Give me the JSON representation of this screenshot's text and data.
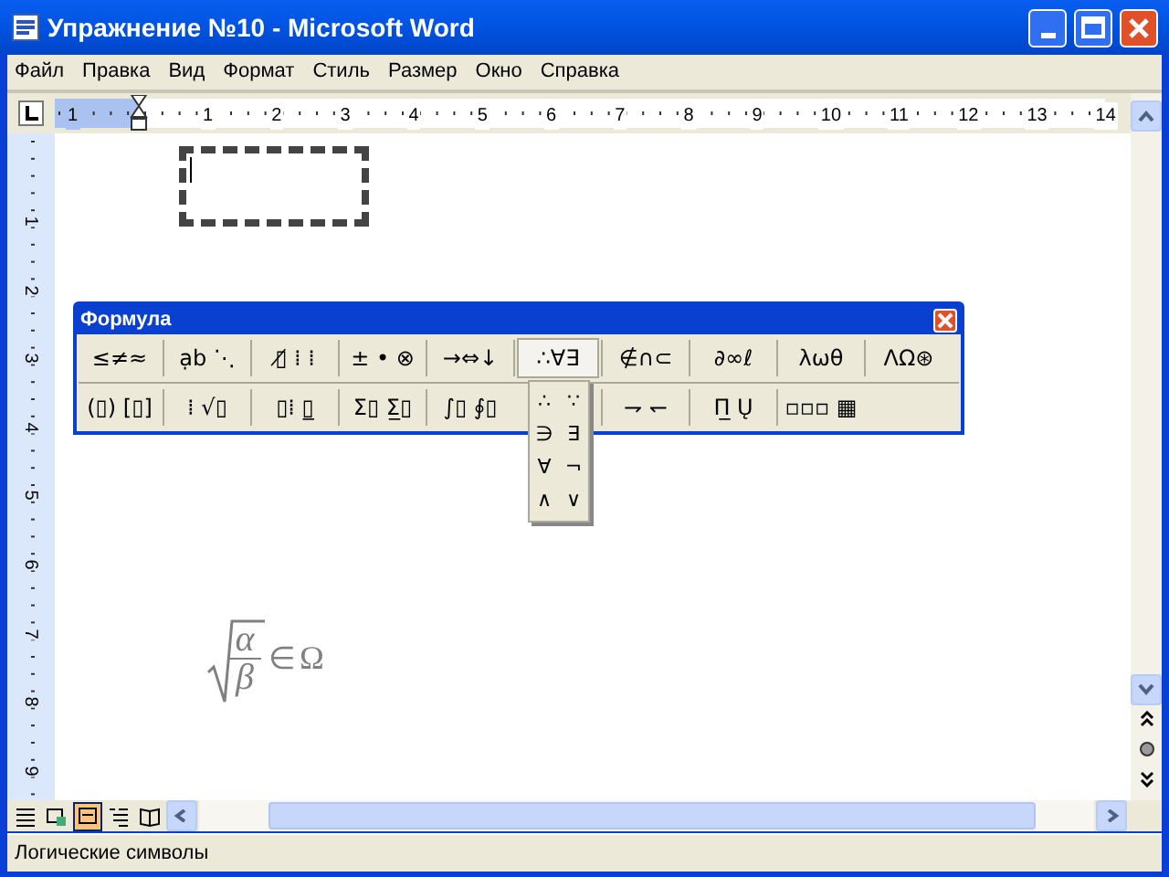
{
  "window": {
    "title": "Упражнение №10 - Microsoft Word"
  },
  "menu": [
    "Файл",
    "Правка",
    "Вид",
    "Формат",
    "Стиль",
    "Размер",
    "Окно",
    "Справка"
  ],
  "ruler": {
    "left_label": "1",
    "labels": [
      "1",
      "2",
      "3",
      "4",
      "5",
      "6",
      "7",
      "8",
      "9",
      "10",
      "11",
      "12",
      "13",
      "14"
    ]
  },
  "vertical_ruler": {
    "labels": [
      "1",
      "2",
      "3",
      "4",
      "5",
      "6",
      "7",
      "8",
      "9"
    ]
  },
  "formula_toolbar": {
    "title": "Формула",
    "row_1": [
      {
        "label": "≤≠≈",
        "selected": false
      },
      {
        "label": "ạb ⋱",
        "selected": false
      },
      {
        "label": "▯̸ ⁞ ⁞",
        "selected": false
      },
      {
        "label": "± • ⊗",
        "selected": false
      },
      {
        "label": "→⇔↓",
        "selected": false
      },
      {
        "label": "∴∀∃",
        "selected": true
      },
      {
        "label": "∉∩⊂",
        "selected": false
      },
      {
        "label": "∂∞ℓ",
        "selected": false
      },
      {
        "label": "λωθ",
        "selected": false
      },
      {
        "label": "ΛΩ⊛",
        "selected": false
      }
    ],
    "row_2": [
      {
        "label": "(▯) [▯]"
      },
      {
        "label": "⁞ √▯"
      },
      {
        "label": "▯⁞ ▯̲"
      },
      {
        "label": "Σ▯ Σ̲▯"
      },
      {
        "label": "∫▯ ∮▯"
      },
      {
        "label": "⇁ ↽"
      },
      {
        "label": "Π̲ Ų"
      },
      {
        "label": "▫▫▫ ▦"
      }
    ],
    "palette": [
      "∴",
      "∵",
      "∋",
      "∃",
      "∀",
      "¬",
      "∧",
      "∨"
    ]
  },
  "formula": {
    "numerator": "α",
    "denominator": "β",
    "relation": "∈",
    "set": "Ω"
  },
  "status_bar": "Логические символы"
}
